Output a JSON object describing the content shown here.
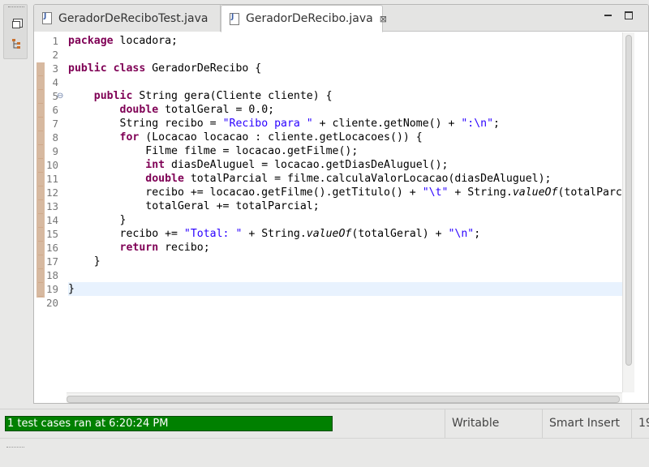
{
  "tabs": [
    {
      "label": "GeradorDeReciboTest.java",
      "active": false
    },
    {
      "label": "GeradorDeRecibo.java",
      "active": true,
      "close": "⊠"
    }
  ],
  "line_numbers": [
    "1",
    "2",
    "3",
    "4",
    "5",
    "6",
    "7",
    "8",
    "9",
    "10",
    "11",
    "12",
    "13",
    "14",
    "15",
    "16",
    "17",
    "18",
    "19",
    "20"
  ],
  "code_lines": [
    "package locadora;",
    "",
    "public class GeradorDeRecibo {",
    "",
    "    public String gera(Cliente cliente) {",
    "        double totalGeral = 0.0;",
    "        String recibo = \"Recibo para \" + cliente.getNome() + \":\\n\";",
    "        for (Locacao locacao : cliente.getLocacoes()) {",
    "            Filme filme = locacao.getFilme();",
    "            int diasDeAluguel = locacao.getDiasDeAluguel();",
    "            double totalParcial = filme.calculaValorLocacao(diasDeAluguel);",
    "            recibo += locacao.getFilme().getTitulo() + \"\\t\" + String.valueOf(totalParcial",
    "            totalGeral += totalParcial;",
    "        }",
    "        recibo += \"Total: \" + String.valueOf(totalGeral) + \"\\n\";",
    "        return recibo;",
    "    }",
    "",
    "}",
    ""
  ],
  "status": {
    "junit": "1 test cases ran at 6:20:24 PM",
    "writable": "Writable",
    "insert_mode": "Smart Insert",
    "position": "19"
  },
  "colors": {
    "keyword": "#7f0055",
    "string": "#2a00ff",
    "junit_pass": "#008000",
    "current_line": "#e8f2fe"
  }
}
